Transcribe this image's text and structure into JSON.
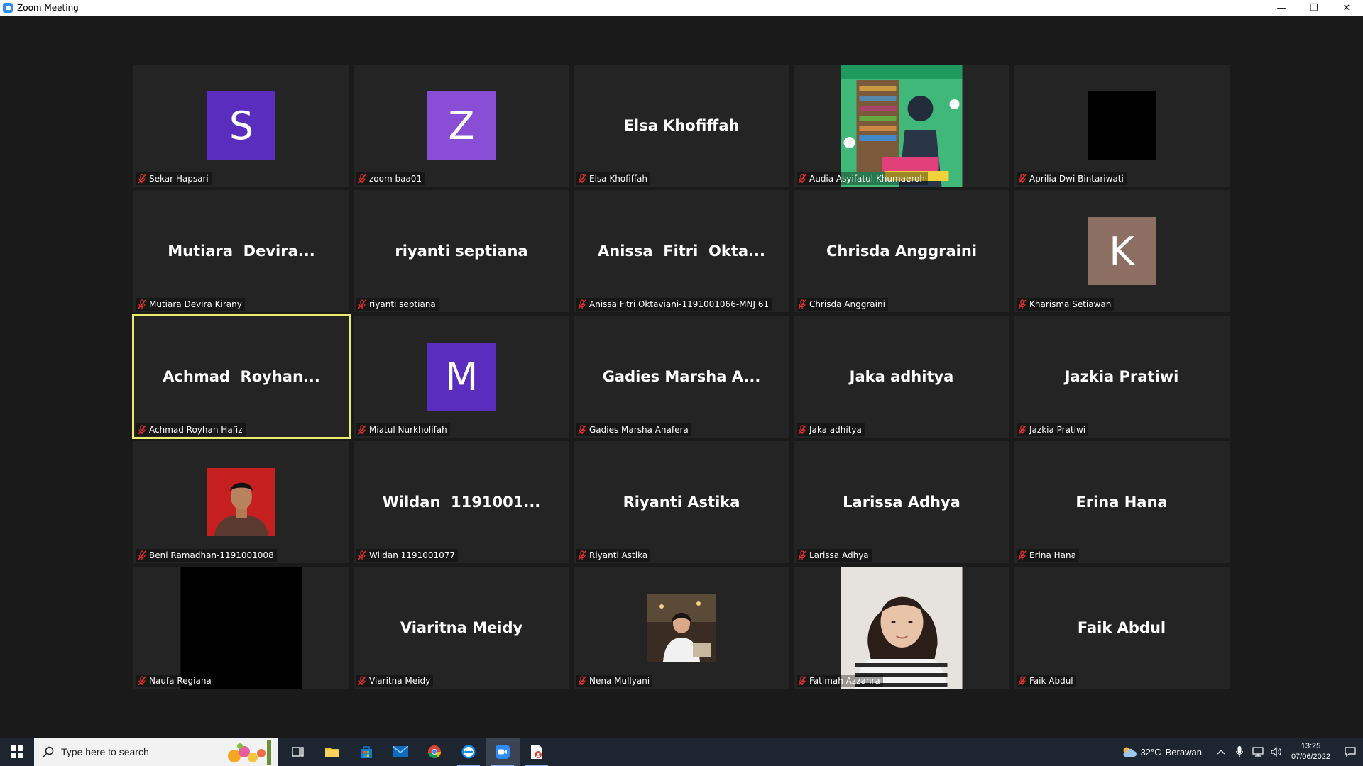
{
  "window": {
    "title": "Zoom Meeting",
    "minimize_glyph": "—",
    "restore_glyph": "❐",
    "close_glyph": "✕"
  },
  "participants": [
    {
      "label": "Sekar Hapsari",
      "kind": "avatar",
      "initial": "S",
      "color": "#5b2dbf"
    },
    {
      "label": "zoom baa01",
      "kind": "avatar",
      "initial": "Z",
      "color": "#8a4dd6"
    },
    {
      "label": "Elsa Khofiffah",
      "kind": "name",
      "display": "Elsa Khofiffah"
    },
    {
      "label": "Audia Asyifatul Khumaeroh",
      "kind": "photo-poster"
    },
    {
      "label": "Aprilia Dwi Bintariwati",
      "kind": "black-square"
    },
    {
      "label": "Mutiara Devira Kirany",
      "kind": "name",
      "display": "Mutiara  Devira..."
    },
    {
      "label": "riyanti septiana",
      "kind": "name",
      "display": "riyanti septiana"
    },
    {
      "label": "Anissa Fitri Oktaviani-1191001066-MNJ 61",
      "kind": "name",
      "display": "Anissa  Fitri  Okta..."
    },
    {
      "label": "Chrisda Anggraini",
      "kind": "name",
      "display": "Chrisda Anggraini"
    },
    {
      "label": "Kharisma Setiawan",
      "kind": "avatar",
      "initial": "K",
      "color": "#8c6e62"
    },
    {
      "label": "Achmad Royhan Hafiz",
      "kind": "name",
      "display": "Achmad  Royhan...",
      "active": true
    },
    {
      "label": "Miatul Nurkholifah",
      "kind": "avatar",
      "initial": "M",
      "color": "#5b2dbf"
    },
    {
      "label": "Gadies Marsha Anafera",
      "kind": "name",
      "display": "Gadies Marsha A..."
    },
    {
      "label": "Jaka adhitya",
      "kind": "name",
      "display": "Jaka adhitya"
    },
    {
      "label": "Jazkia Pratiwi",
      "kind": "name",
      "display": "Jazkia Pratiwi"
    },
    {
      "label": "Beni Ramadhan-1191001008",
      "kind": "photo-portrait"
    },
    {
      "label": "Wildan 1191001077",
      "kind": "name",
      "display": "Wildan  1191001..."
    },
    {
      "label": "Riyanti Astika",
      "kind": "name",
      "display": "Riyanti Astika"
    },
    {
      "label": "Larissa Adhya",
      "kind": "name",
      "display": "Larissa Adhya"
    },
    {
      "label": "Erina Hana",
      "kind": "name",
      "display": "Erina Hana"
    },
    {
      "label": "Naufa Regiana",
      "kind": "black-video"
    },
    {
      "label": "Viaritna Meidy",
      "kind": "name",
      "display": "Viaritna Meidy"
    },
    {
      "label": "Nena Mullyani",
      "kind": "photo-small"
    },
    {
      "label": "Fatimah Azzahra",
      "kind": "photo-face"
    },
    {
      "label": "Faik Abdul",
      "kind": "name",
      "display": "Faik Abdul"
    }
  ],
  "taskbar": {
    "search_placeholder": "Type here to search",
    "weather_temp": "32°C",
    "weather_desc": "Berawan",
    "time": "13:25",
    "date": "07/06/2022"
  }
}
